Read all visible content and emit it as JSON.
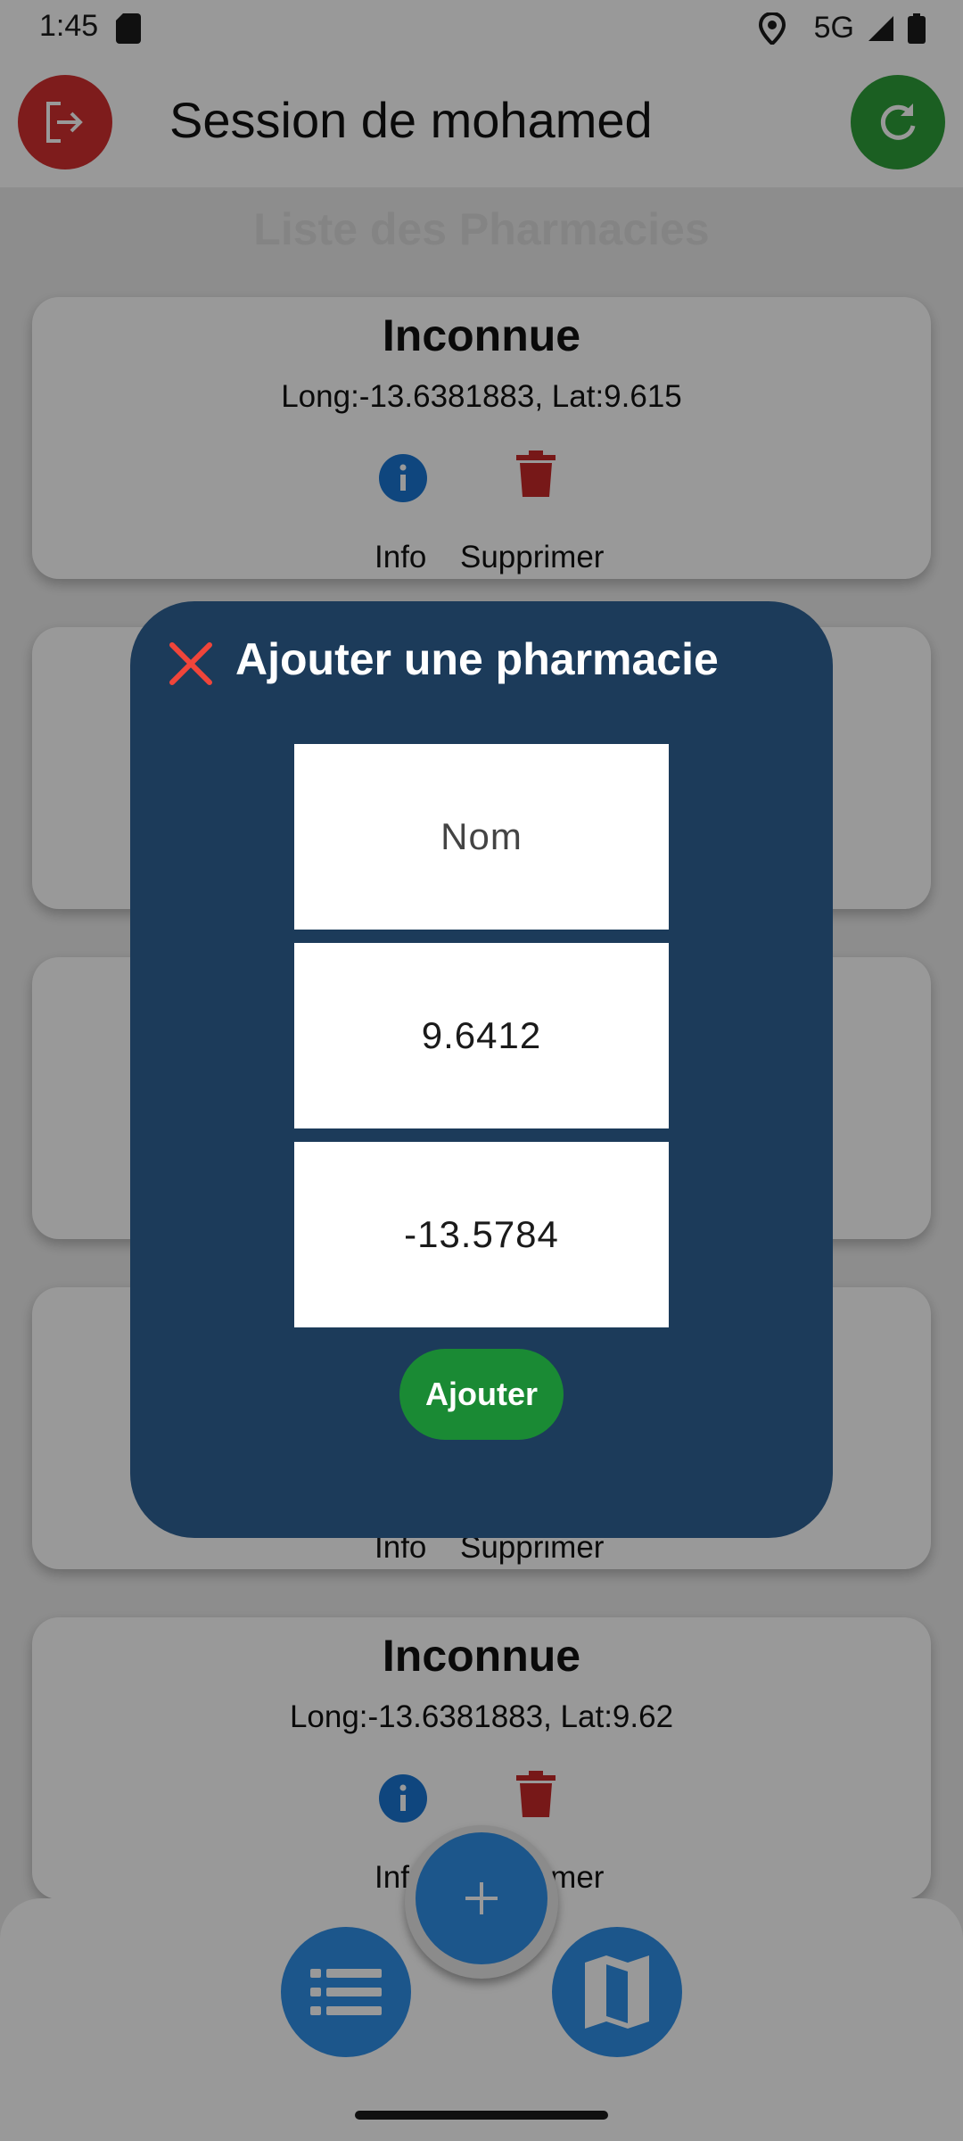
{
  "status_bar": {
    "time": "1:45",
    "network": "5G"
  },
  "app_bar": {
    "title": "Session de mohamed"
  },
  "list": {
    "title": "Liste des Pharmacies",
    "cards": [
      {
        "name": "Inconnue",
        "coords": "Long:-13.6381883,  Lat:9.615",
        "info_label": "Info",
        "delete_label": "Supprimer"
      },
      {
        "name": "",
        "coords": "",
        "info_label": "",
        "delete_label": ""
      },
      {
        "name": "",
        "coords": "",
        "info_label": "",
        "delete_label": ""
      },
      {
        "name": "",
        "coords": "",
        "info_label": "Info",
        "delete_label": "Supprimer"
      },
      {
        "name": "Inconnue",
        "coords": "Long:-13.6381883,  Lat:9.62",
        "info_label": "Info",
        "delete_label": "Supprimer"
      }
    ]
  },
  "dialog": {
    "title": "Ajouter une pharmacie",
    "name_placeholder": "Nom",
    "latitude_value": "9.6412",
    "longitude_value": "-13.5784",
    "submit_label": "Ajouter"
  },
  "colors": {
    "dialog_bg": "#1c3b5a",
    "logout": "#d32f2f",
    "refresh": "#2e9e3a",
    "fab": "#2f8fe8",
    "submit": "#1a8a34",
    "delete": "#c62828",
    "info": "#1976d2"
  },
  "icons": {
    "app_bar_left": "logout-icon",
    "app_bar_right": "refresh-icon",
    "dialog_close": "close-icon",
    "card_info": "info-icon",
    "card_delete": "trash-icon",
    "bottom_left": "list-icon",
    "bottom_center": "add-icon",
    "bottom_right": "map-icon"
  }
}
